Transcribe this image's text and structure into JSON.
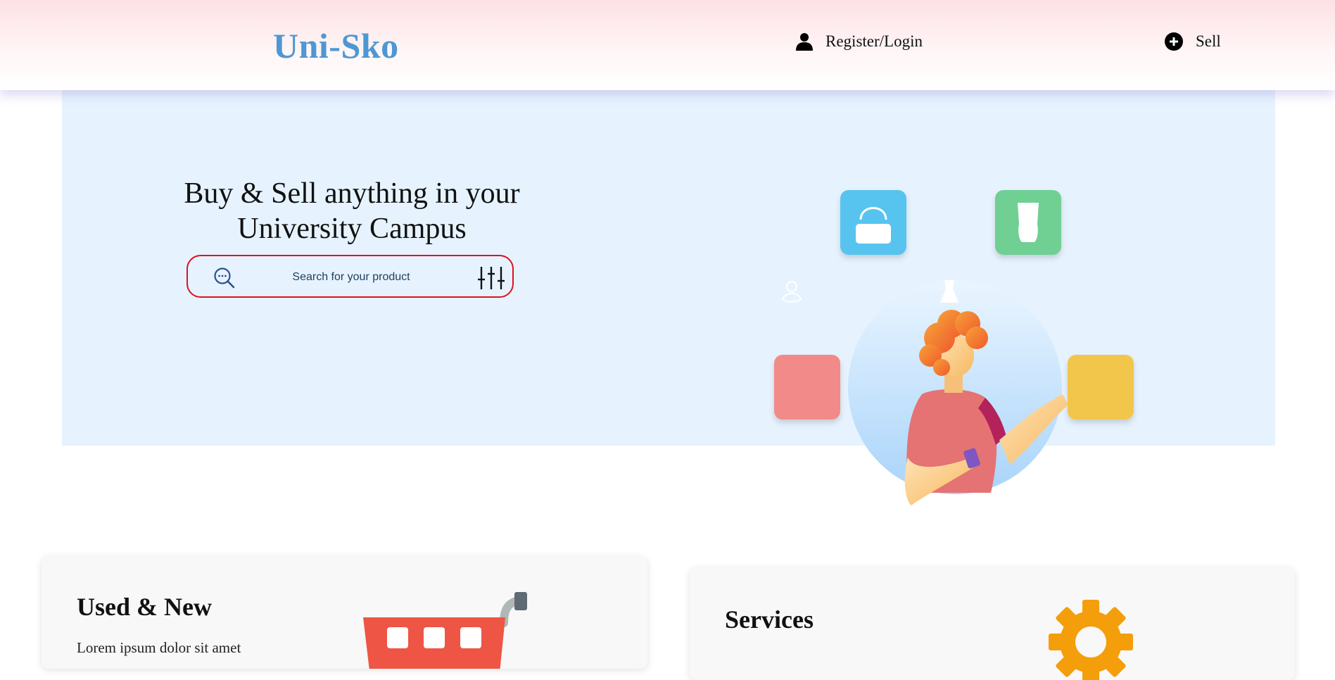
{
  "header": {
    "logo": "Uni-Sko",
    "login_label": "Register/Login",
    "sell_label": "Sell",
    "login_icon": "user-icon",
    "sell_icon": "plus-circle-icon"
  },
  "hero": {
    "title_line1": "Buy & Sell anything in your",
    "title_line2": "University Campus",
    "search": {
      "placeholder": "Search for your product",
      "value": "",
      "search_icon": "search-icon",
      "filter_icon": "sliders-icon"
    },
    "illustration_icons": [
      "handbag-icon",
      "shirt-icon",
      "dress-icon",
      "flower-icon"
    ]
  },
  "cards": [
    {
      "title": "Used & New",
      "text": "Lorem ipsum dolor sit amet",
      "icon": "shopping-cart-icon"
    },
    {
      "title": "Services",
      "text": "",
      "icon": "gear-icon"
    }
  ],
  "colors": {
    "logo": "#4f97d4",
    "hero_bg": "#e6f3fe",
    "search_border": "#e0101e",
    "card_bg": "#f8f8f8",
    "tile_blue": "#56c4ef",
    "tile_green": "#6fcf93",
    "tile_red": "#f28a8a",
    "tile_yellow": "#f2c64c"
  }
}
